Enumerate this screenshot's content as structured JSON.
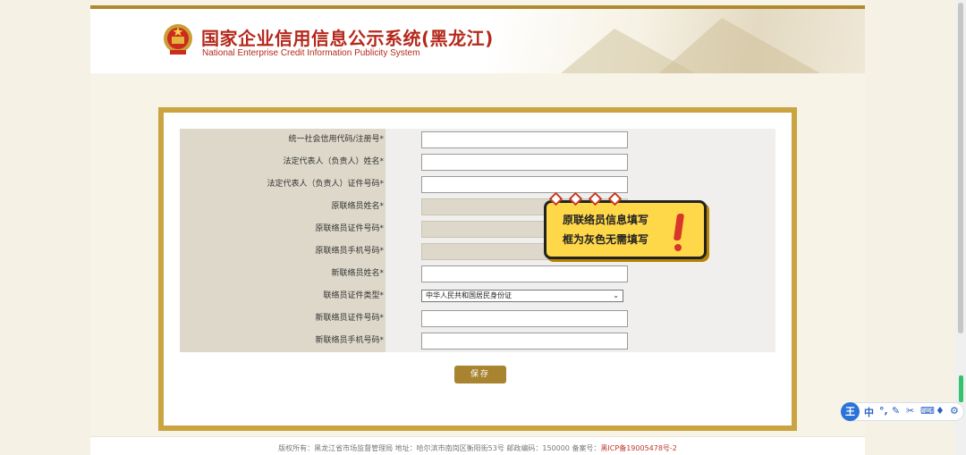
{
  "header": {
    "title": "国家企业信用信息公示系统(黑龙江)",
    "subtitle": "National Enterprise Credit Information Publicity System"
  },
  "form": {
    "rows": [
      {
        "label": "统一社会信用代码/注册号*",
        "type": "text",
        "value": "",
        "disabled": false
      },
      {
        "label": "法定代表人（负责人）姓名*",
        "type": "text",
        "value": "",
        "disabled": false
      },
      {
        "label": "法定代表人（负责人）证件号码*",
        "type": "text",
        "value": "",
        "disabled": false
      },
      {
        "label": "原联络员姓名*",
        "type": "text",
        "value": "",
        "disabled": true
      },
      {
        "label": "原联络员证件号码*",
        "type": "text",
        "value": "",
        "disabled": true
      },
      {
        "label": "原联络员手机号码*",
        "type": "text",
        "value": "",
        "disabled": true
      },
      {
        "label": "新联络员姓名*",
        "type": "text",
        "value": "",
        "disabled": false
      },
      {
        "label": "联络员证件类型*",
        "type": "select",
        "value": "中华人民共和国居民身份证",
        "disabled": false
      },
      {
        "label": "新联络员证件号码*",
        "type": "text",
        "value": "",
        "disabled": false
      },
      {
        "label": "新联络员手机号码*",
        "type": "text",
        "value": "",
        "disabled": false
      }
    ],
    "save_label": "保存"
  },
  "callout": {
    "line1": "原联络员信息填写",
    "line2": "框为灰色无需填写"
  },
  "footer": {
    "text": "版权所有：黑龙江省市场监督管理局 地址：哈尔滨市南岗区衡阳街53号 邮政编码：150000 备案号：",
    "icp": "黑ICP备19005478号-2"
  },
  "ime": {
    "logo": "王",
    "mode": "中"
  },
  "colors": {
    "accent_gold": "#c9a441",
    "title_red": "#b5291c",
    "callout_yellow": "#ffd84a",
    "save_button": "#a88330"
  }
}
